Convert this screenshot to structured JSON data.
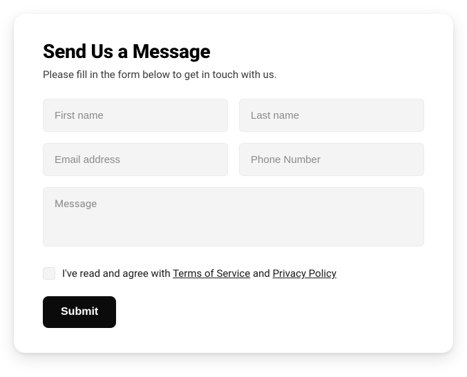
{
  "form": {
    "title": "Send Us a Message",
    "subtitle": "Please fill in the form below to get in touch with us.",
    "fields": {
      "first_name": {
        "placeholder": "First name",
        "value": ""
      },
      "last_name": {
        "placeholder": "Last name",
        "value": ""
      },
      "email": {
        "placeholder": "Email address",
        "value": ""
      },
      "phone": {
        "placeholder": "Phone Number",
        "value": ""
      },
      "message": {
        "placeholder": "Message",
        "value": ""
      }
    },
    "agree": {
      "checked": false,
      "prefix": "I've read and agree with ",
      "tos_label": "Terms of Service",
      "connector": " and ",
      "privacy_label": "Privacy Policy"
    },
    "submit_label": "Submit"
  }
}
